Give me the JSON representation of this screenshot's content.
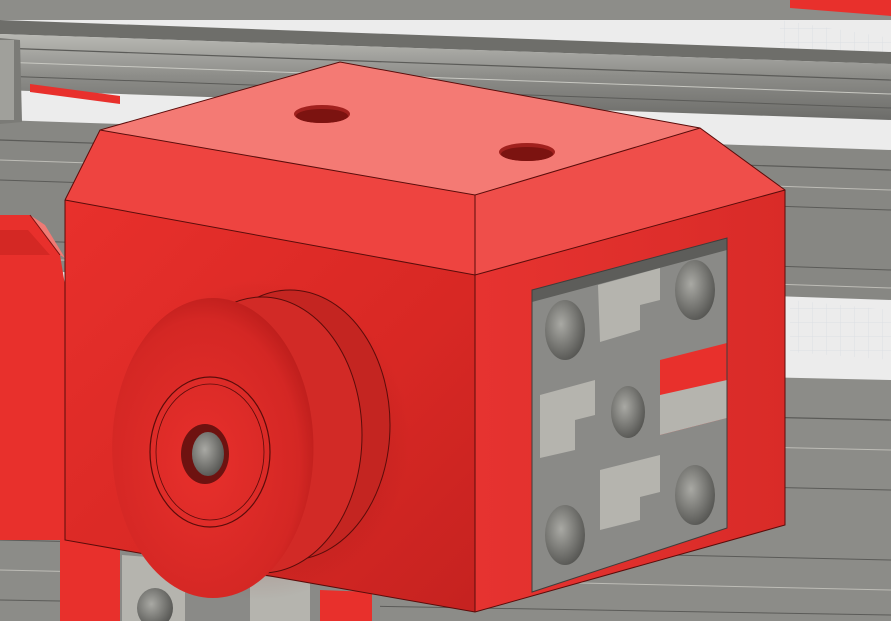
{
  "viewport": {
    "title": "",
    "background_color": "#ececec",
    "grid_color": "#d6dbe2"
  },
  "model": {
    "part_color": "#e8302c",
    "part_highlight": "#f47a74",
    "part_shadow": "#b81c1a",
    "extrusion_color": "#8a8a87",
    "extrusion_dark": "#5d5d5a",
    "extrusion_light": "#b5b4ae",
    "components": [
      "rail-top",
      "rail-middle",
      "rail-lower",
      "corner-block",
      "idler-pulley",
      "aluminum-extrusion-profile",
      "side-bracket-left",
      "lower-extrusion-left"
    ]
  }
}
